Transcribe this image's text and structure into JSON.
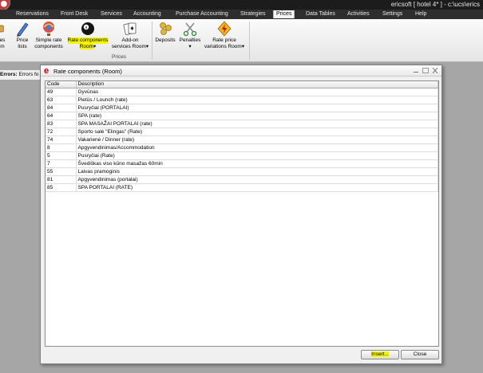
{
  "window": {
    "title": "ericsoft [ hotel 4* ] - c:\\ucs\\erics"
  },
  "menu": {
    "tabs": [
      {
        "label": "Reservations"
      },
      {
        "label": "Front Desk"
      },
      {
        "label": "Services"
      },
      {
        "label": "Accounting"
      },
      {
        "label": "Purchase Accounting"
      },
      {
        "label": "Strategies"
      },
      {
        "label": "Prices"
      },
      {
        "label": "Data Tables"
      },
      {
        "label": "Activities"
      },
      {
        "label": "Settings"
      },
      {
        "label": "Help"
      }
    ],
    "active": "Prices"
  },
  "ribbon": {
    "left_fragment": {
      "l1": "es",
      "l2": "m"
    },
    "price_lists": {
      "l1": "Price",
      "l2": "lists"
    },
    "simple_rate_components": {
      "l1": "Simple rate",
      "l2": "components"
    },
    "rate_components_room": {
      "l1": "Rate components",
      "l2": "Room"
    },
    "addon_services_room": {
      "l1": "Add-on",
      "l2": "services Room"
    },
    "deposits": {
      "l1": "Deposits"
    },
    "penalties": {
      "l1": "Penalties"
    },
    "rate_price_variations_room": {
      "l1": "Rate price",
      "l2": "variations Room"
    },
    "group_label": "Prices"
  },
  "errors": {
    "label": "Errors:",
    "text": "Errors fo"
  },
  "dialog": {
    "title": "Rate components (Room)",
    "columns": [
      "Code",
      "Description"
    ],
    "rows": [
      {
        "code": "49",
        "description": "Gyvūnas"
      },
      {
        "code": "63",
        "description": "Pietūs / Lounch (rate)"
      },
      {
        "code": "84",
        "description": "Pusryčiai (PORTALAI)"
      },
      {
        "code": "64",
        "description": "SPA (rate)"
      },
      {
        "code": "83",
        "description": "SPA MASAŽAI PORTALAI (rate)"
      },
      {
        "code": "72",
        "description": "Sporto salė \"Elingas\" (Rate)"
      },
      {
        "code": "74",
        "description": "Vakarienė / Dinner (rate)"
      },
      {
        "code": "8",
        "description": "Apgyvendinimas/Accommodation"
      },
      {
        "code": "5",
        "description": "Pusryčiai (Rate)"
      },
      {
        "code": "7",
        "description": "Švediškas viso kūno masažas 60min"
      },
      {
        "code": "55",
        "description": "Laivas pramoginis"
      },
      {
        "code": "81",
        "description": "Apgyvendinimas (portalai)"
      },
      {
        "code": "85",
        "description": "SPA PORTALAI (RATE)"
      }
    ],
    "insert_label": "Insert...",
    "close_label": "Close"
  },
  "colors": {
    "highlight": "#f5f500",
    "accent_icon": "#c00000"
  }
}
